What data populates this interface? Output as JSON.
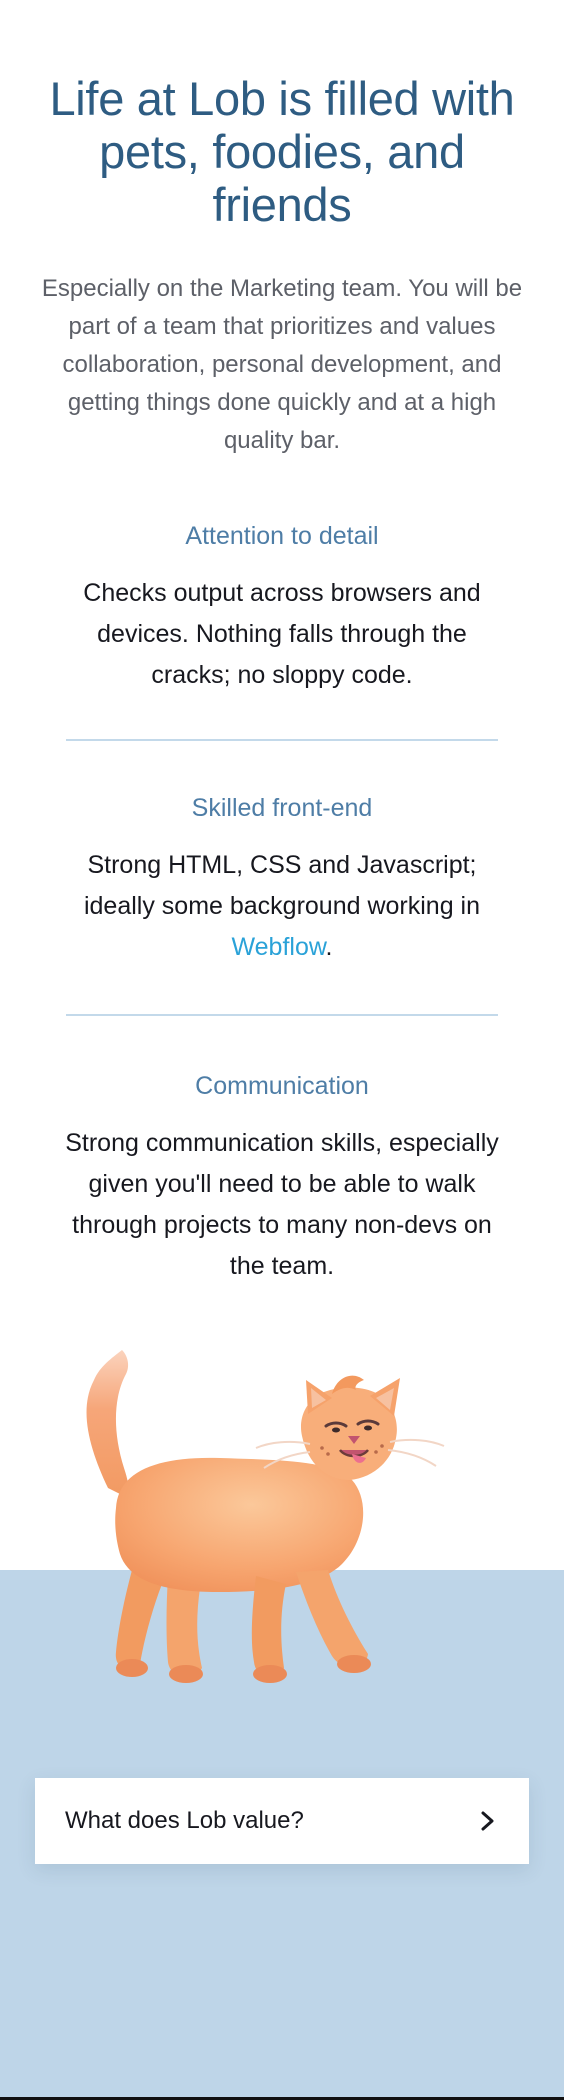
{
  "hero": {
    "title": "Life at Lob is filled with pets, foodies, and friends",
    "intro": "Especially on the Marketing team. You will be part of a team that prioritizes and values collaboration, personal development, and getting things done quickly and at a high quality bar."
  },
  "qualities": [
    {
      "heading": "Attention to detail",
      "text": "Checks output across browsers and devices. Nothing falls through the cracks; no sloppy code."
    },
    {
      "heading": "Skilled front-end",
      "text_before": "Strong HTML, CSS and Javascript; ideally some background working in",
      "link": "Webflow",
      "text_after": "."
    },
    {
      "heading": "Communication",
      "text": "Strong communication skills, especially given you'll need to be able to walk through projects to many non-devs on the team."
    }
  ],
  "illustration": {
    "icon": "cat-illustration"
  },
  "value_card": {
    "label": "What does Lob value?",
    "icon": "chevron-right-icon"
  },
  "colors": {
    "title": "#2e5c82",
    "heading": "#4e7da6",
    "link": "#2aa2d8",
    "band": "#bed5e8",
    "divider": "#c3d9ea"
  }
}
